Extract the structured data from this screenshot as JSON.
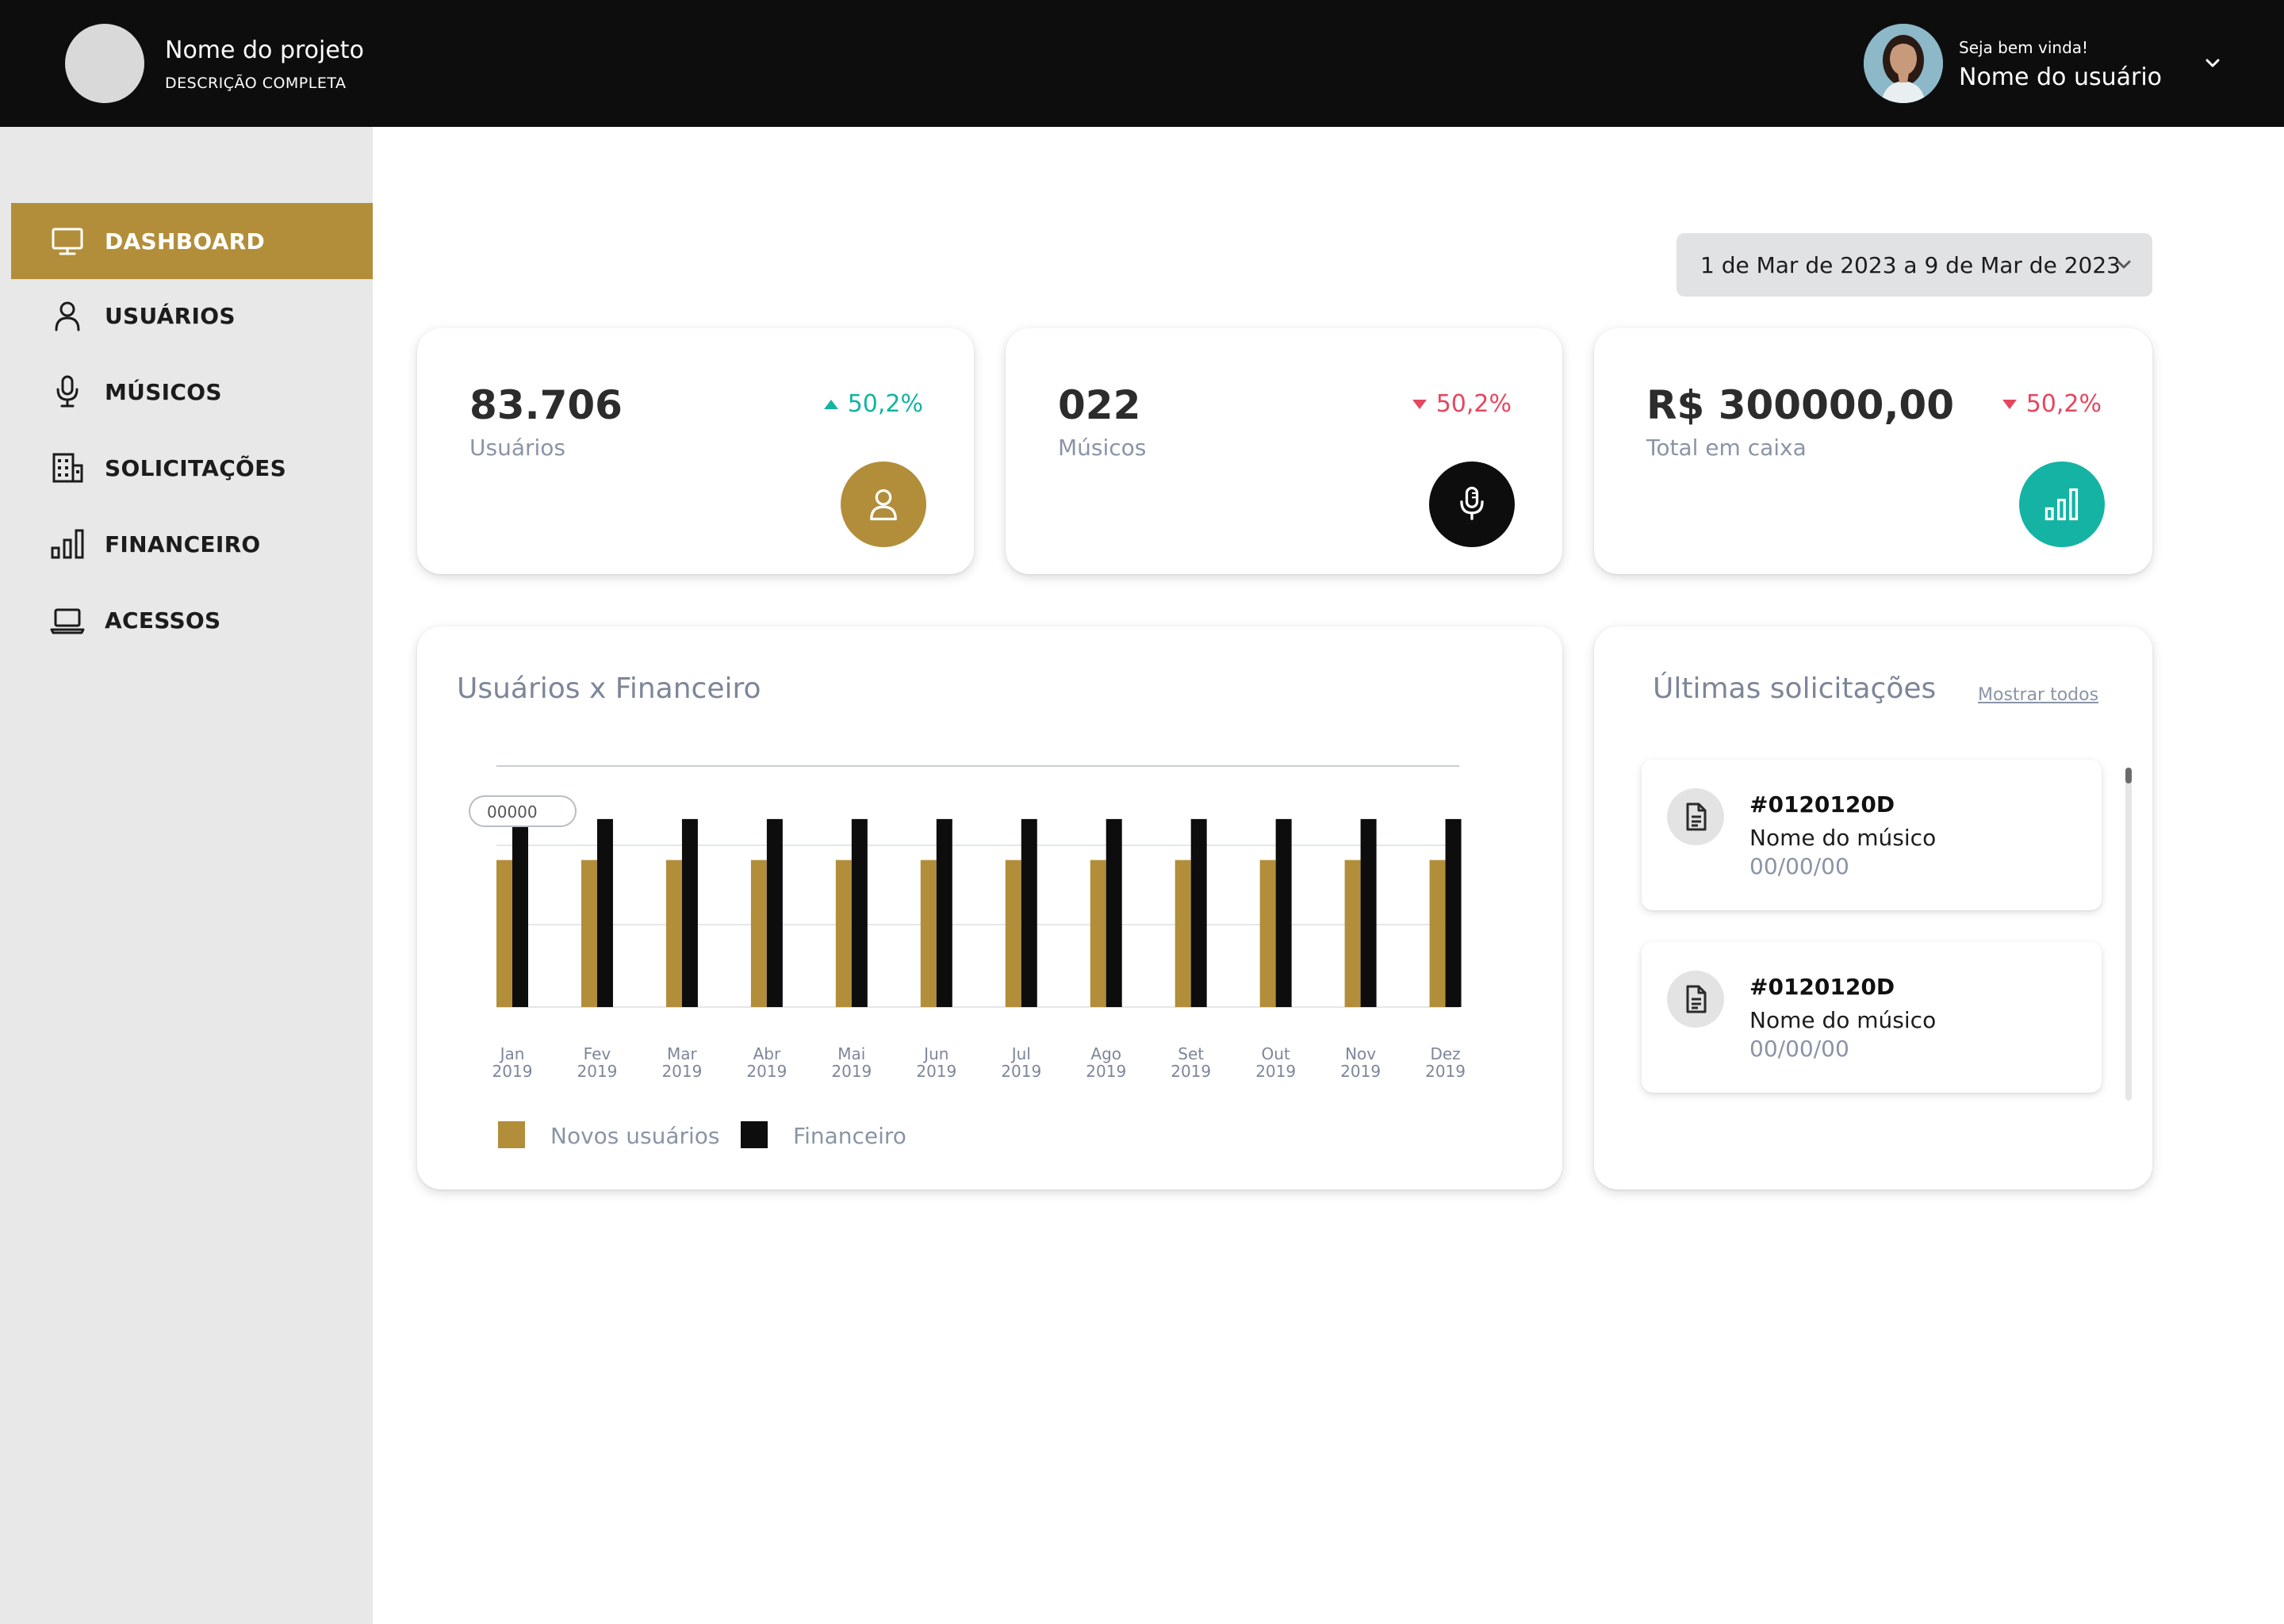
{
  "header": {
    "project_name": "Nome do projeto",
    "project_description": "DESCRIÇÃO COMPLETA",
    "welcome": "Seja bem vinda!",
    "user_name": "Nome do usuário"
  },
  "sidebar": {
    "items": [
      {
        "label": "DASHBOARD",
        "icon": "monitor-icon",
        "active": true
      },
      {
        "label": "USUÁRIOS",
        "icon": "user-icon",
        "active": false
      },
      {
        "label": "MÚSICOS",
        "icon": "microphone-icon",
        "active": false
      },
      {
        "label": "SOLICITAÇÕES",
        "icon": "building-icon",
        "active": false
      },
      {
        "label": "FINANCEIRO",
        "icon": "bar-chart-icon",
        "active": false
      },
      {
        "label": "ACESSOS",
        "icon": "laptop-icon",
        "active": false
      }
    ]
  },
  "date_range": "1 de Mar de 2023 a 9 de Mar de 2023",
  "stats": [
    {
      "value": "83.706",
      "label": "Usuários",
      "change": "50,2%",
      "trend": "up",
      "icon": "user-icon",
      "color": "#b28e3a"
    },
    {
      "value": "022",
      "label": "Músicos",
      "change": "50,2%",
      "trend": "down",
      "icon": "microphone-icon",
      "color": "#0d0d0d"
    },
    {
      "value": "R$ 300000,00",
      "label": "Total em caixa",
      "change": "50,2%",
      "trend": "down",
      "icon": "bar-chart-icon",
      "color": "#14b3a3"
    }
  ],
  "chart": {
    "title": "Usuários x Financeiro",
    "tooltip": "00000",
    "legend": [
      "Novos usuários",
      "Financeiro"
    ]
  },
  "chart_data": {
    "type": "bar",
    "categories": [
      "Jan 2019",
      "Fev 2019",
      "Mar 2019",
      "Abr 2019",
      "Mai 2019",
      "Jun 2019",
      "Jul 2019",
      "Ago 2019",
      "Set 2019",
      "Out 2019",
      "Nov 2019",
      "Dez 2019"
    ],
    "category_lines": [
      [
        "Jan",
        "2019"
      ],
      [
        "Fev",
        "2019"
      ],
      [
        "Mar",
        "2019"
      ],
      [
        "Abr",
        "2019"
      ],
      [
        "Mai",
        "2019"
      ],
      [
        "Jun",
        "2019"
      ],
      [
        "Jul",
        "2019"
      ],
      [
        "Ago",
        "2019"
      ],
      [
        "Set",
        "2019"
      ],
      [
        "Out",
        "2019"
      ],
      [
        "Nov",
        "2019"
      ],
      [
        "Dez",
        "2019"
      ]
    ],
    "series": [
      {
        "name": "Novos usuários",
        "color": "#b28e3a",
        "values": [
          0.61,
          0.61,
          0.61,
          0.61,
          0.61,
          0.61,
          0.61,
          0.61,
          0.61,
          0.61,
          0.61,
          0.61
        ]
      },
      {
        "name": "Financeiro",
        "color": "#0d0d0d",
        "values": [
          0.78,
          0.78,
          0.78,
          0.78,
          0.78,
          0.78,
          0.78,
          0.78,
          0.78,
          0.78,
          0.78,
          0.78
        ]
      }
    ],
    "ylim": [
      0,
      1
    ],
    "grid": true,
    "legend_position": "bottom-left"
  },
  "requests": {
    "title": "Últimas solicitações",
    "show_all": "Mostrar todos",
    "items": [
      {
        "id": "#0120120D",
        "name": "Nome do músico",
        "date": "00/00/00"
      },
      {
        "id": "#0120120D",
        "name": "Nome do músico",
        "date": "00/00/00"
      }
    ]
  }
}
